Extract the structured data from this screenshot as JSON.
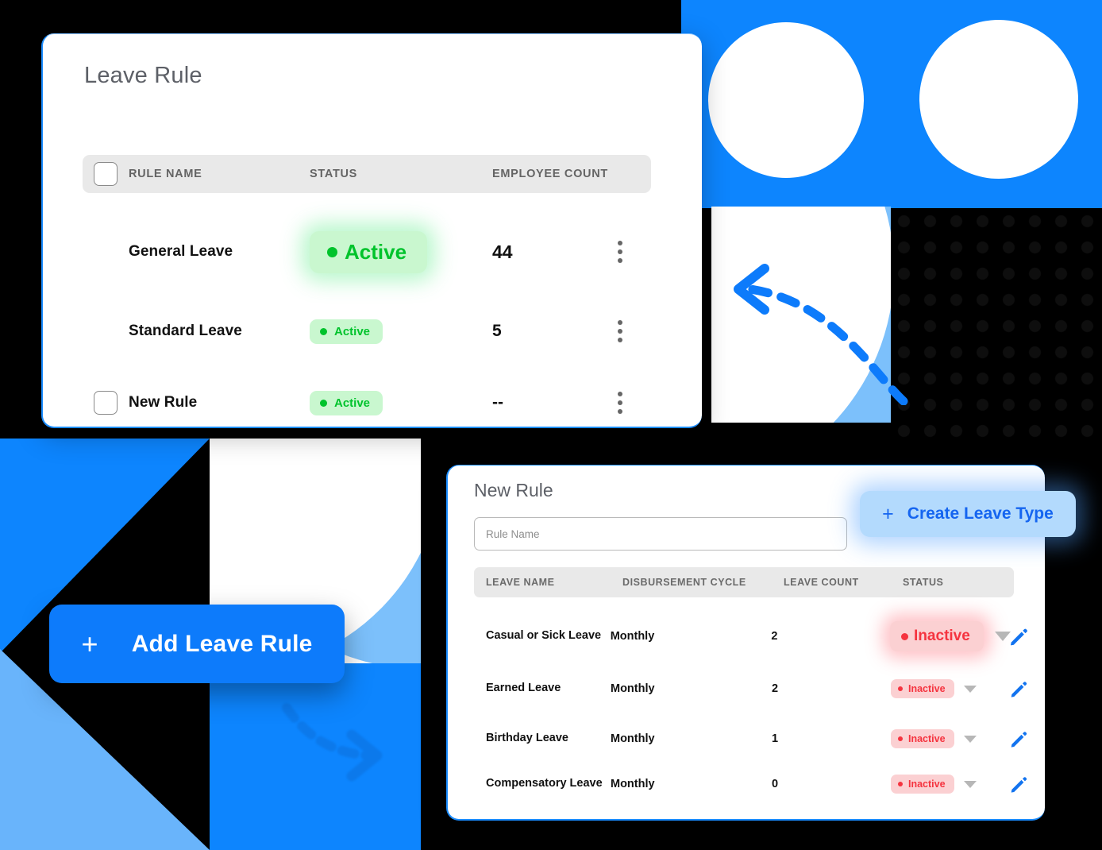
{
  "colors": {
    "brand_blue": "#0d7bfb",
    "light_blue": "#7cc0fb",
    "active_green": "#00c32c",
    "active_green_bg": "#c9f7cf",
    "inactive_red": "#f5333f",
    "inactive_red_bg": "#fbd0d2",
    "header_gray": "#e9e9e9",
    "black": "#000000"
  },
  "leave_rule_card": {
    "title": "Leave Rule",
    "columns": [
      "RULE NAME",
      "STATUS",
      "EMPLOYEE COUNT"
    ],
    "header_checkbox_checked": false,
    "rows": [
      {
        "name": "General Leave",
        "status": "Active",
        "employee_count": "44",
        "has_checkbox": false,
        "highlighted": true
      },
      {
        "name": "Standard Leave",
        "status": "Active",
        "employee_count": "5",
        "has_checkbox": false,
        "highlighted": false
      },
      {
        "name": "New Rule",
        "status": "Active",
        "employee_count": "--",
        "has_checkbox": true,
        "highlighted": false
      }
    ],
    "row_menu_icon": "kebab-menu-icon"
  },
  "new_rule_card": {
    "title": "New Rule",
    "rule_name_input": {
      "value": "",
      "placeholder": "Rule Name"
    },
    "create_leave_type_button": {
      "label": "Create Leave Type",
      "icon": "plus-icon"
    },
    "columns": [
      "LEAVE NAME",
      "DISBURSEMENT CYCLE",
      "LEAVE COUNT",
      "STATUS"
    ],
    "rows": [
      {
        "leave_name": "Casual or Sick Leave",
        "cycle": "Monthly",
        "count": "2",
        "status": "Inactive",
        "highlighted": true
      },
      {
        "leave_name": "Earned Leave",
        "cycle": "Monthly",
        "count": "2",
        "status": "Inactive",
        "highlighted": false
      },
      {
        "leave_name": "Birthday Leave",
        "cycle": "Monthly",
        "count": "1",
        "status": "Inactive",
        "highlighted": false
      },
      {
        "leave_name": "Compensatory Leave",
        "cycle": "Monthly",
        "count": "0",
        "status": "Inactive",
        "highlighted": false
      }
    ],
    "edit_icon": "pencil-icon",
    "status_dropdown_icon": "caret-down-icon"
  },
  "add_leave_rule_button": {
    "label": "Add Leave Rule",
    "icon": "plus-icon"
  },
  "decor": {
    "arrow_left_icon": "dashed-arrow-left-icon",
    "arrow_right_icon": "dashed-arrow-right-icon",
    "circle_top_left": "decor-circle",
    "circle_top_right": "decor-circle",
    "dot_grid": "decor-dot-grid"
  }
}
